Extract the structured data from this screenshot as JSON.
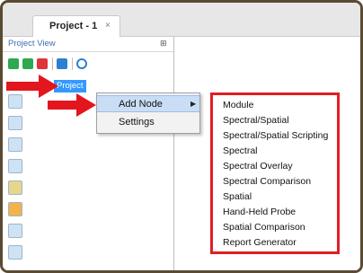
{
  "tab": {
    "title": "Project - 1",
    "close_glyph": "×"
  },
  "project_view": {
    "title": "Project View",
    "pin_glyph": "⊞"
  },
  "toolbar": {
    "icons": [
      "run-icon",
      "step-icon",
      "stop-icon",
      "settings-icon",
      "search-icon"
    ],
    "colors": {
      "green": "#2fa84f",
      "red": "#e0333a",
      "blue": "#2d7fd1"
    }
  },
  "tree": {
    "node_label": "Project"
  },
  "context_menu": {
    "items": [
      {
        "label": "Add Node",
        "has_submenu": true,
        "submenu_arrow": "▶"
      },
      {
        "label": "Settings",
        "has_submenu": false
      }
    ]
  },
  "submenu": {
    "items": [
      "Module",
      "Spectral/Spatial",
      "Spectral/Spatial Scripting",
      "Spectral",
      "Spectral Overlay",
      "Spectral Comparison",
      "Spatial",
      "Hand-Held Probe",
      "Spatial Comparison",
      "Report Generator"
    ],
    "highlight_border_color": "#e01e25"
  },
  "annotation_arrows": {
    "color": "#e3161e",
    "count": 2
  }
}
